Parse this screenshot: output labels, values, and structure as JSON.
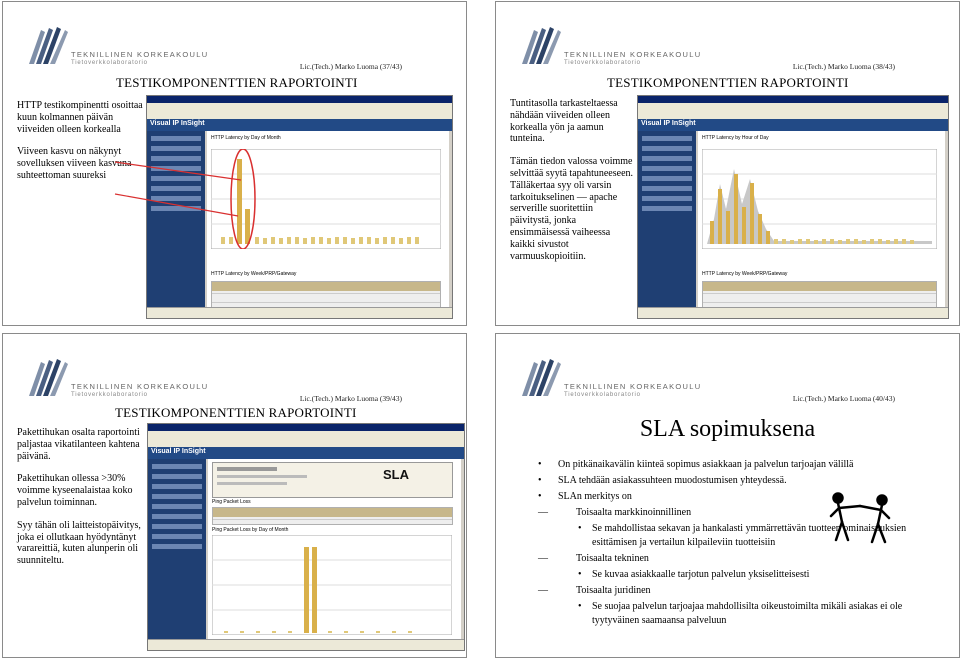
{
  "header": {
    "university": "TEKNILLINEN KORKEAKOULU",
    "department": "Tietoverkkolaboratorio"
  },
  "slides": [
    {
      "author_page": "Lic.(Tech.) Marko Luoma (37/43)",
      "title": "TESTIKOMPONENTTIEN RAPORTOINTI",
      "paragraphs": [
        "HTTP testikompinentti osoittaa kuun kolmannen päivän viiveiden olleen korkealla",
        "Viiveen kasvu on näkynyt sovelluksen viiveen kasvuna suhteettoman suureksi"
      ],
      "screenshot": {
        "app_name": "Visual IP InSight",
        "chart_title": "HTTP Latency by Day of Month",
        "table_title": "HTTP Latency by Week/PRP/Gateway"
      }
    },
    {
      "author_page": "Lic.(Tech.) Marko Luoma (38/43)",
      "title": "TESTIKOMPONENTTIEN RAPORTOINTI",
      "paragraphs": [
        "Tuntitasolla tarkasteltaessa nähdään viiveiden olleen korkealla yön ja aamun tunteina.",
        "Tämän tiedon valossa voimme selvittää syytä tapahtuneeseen. Tälläkertaa syy oli varsin tarkoitukselinen — apache serverille suoritettiin päivitystä, jonka ensimmäisessä vaiheessa kaikki sivustot varmuuskopioitiin."
      ],
      "screenshot": {
        "app_name": "Visual IP InSight",
        "chart_title": "HTTP Latency by Hour of Day",
        "table_title": "HTTP Latency by Week/PRP/Gateway"
      }
    },
    {
      "author_page": "Lic.(Tech.) Marko Luoma (39/43)",
      "title": "TESTIKOMPONENTTIEN RAPORTOINTI",
      "paragraphs": [
        "Pakettihukan osalta raportointi paljastaa vikatilanteen kahtena päivänä.",
        "Pakettihukan ollessa >30% voimme kyseenalaistaa koko palvelun toiminnan.",
        "Syy tähän oli laitteistopäivitys, joka ei ollutkaan hyödyntänyt varareittiä, kuten alunperin oli suunniteltu."
      ],
      "screenshot": {
        "app_name": "Visual IP InSight",
        "report_badge": "SLA",
        "chart_title": "Ping Packet Loss by Day of Month",
        "table_title": "Ping Packet Loss"
      }
    },
    {
      "author_page": "Lic.(Tech.) Marko Luoma (40/43)",
      "title": "SLA sopimuksena",
      "bullets": [
        {
          "level": 1,
          "text": "On pitkänaikavälin kiinteä sopimus asiakkaan ja palvelun tarjoajan välillä"
        },
        {
          "level": 1,
          "text": "SLA tehdään asiakassuhteen muodostumisen yhteydessä."
        },
        {
          "level": 1,
          "text": "SLAn merkitys on"
        },
        {
          "level": 2,
          "text": "Toisaalta markkinoinnillinen"
        },
        {
          "level": 3,
          "text": "Se mahdollistaa sekavan ja hankalasti ymmärrettävän tuotteen ominaisuuksien esittämisen ja vertailun kilpaileviin tuotteisiin"
        },
        {
          "level": 2,
          "text": "Toisaalta tekninen"
        },
        {
          "level": 3,
          "text": "Se kuvaa asiakkaalle tarjotun palvelun yksiselitteisesti"
        },
        {
          "level": 2,
          "text": "Toisaalta juridinen"
        },
        {
          "level": 3,
          "text": "Se suojaa palvelun tarjoajaa mahdollisilta oikeustoimilta mikäli asiakas ei ole tyytyväinen saamaansa palveluun"
        }
      ]
    }
  ]
}
